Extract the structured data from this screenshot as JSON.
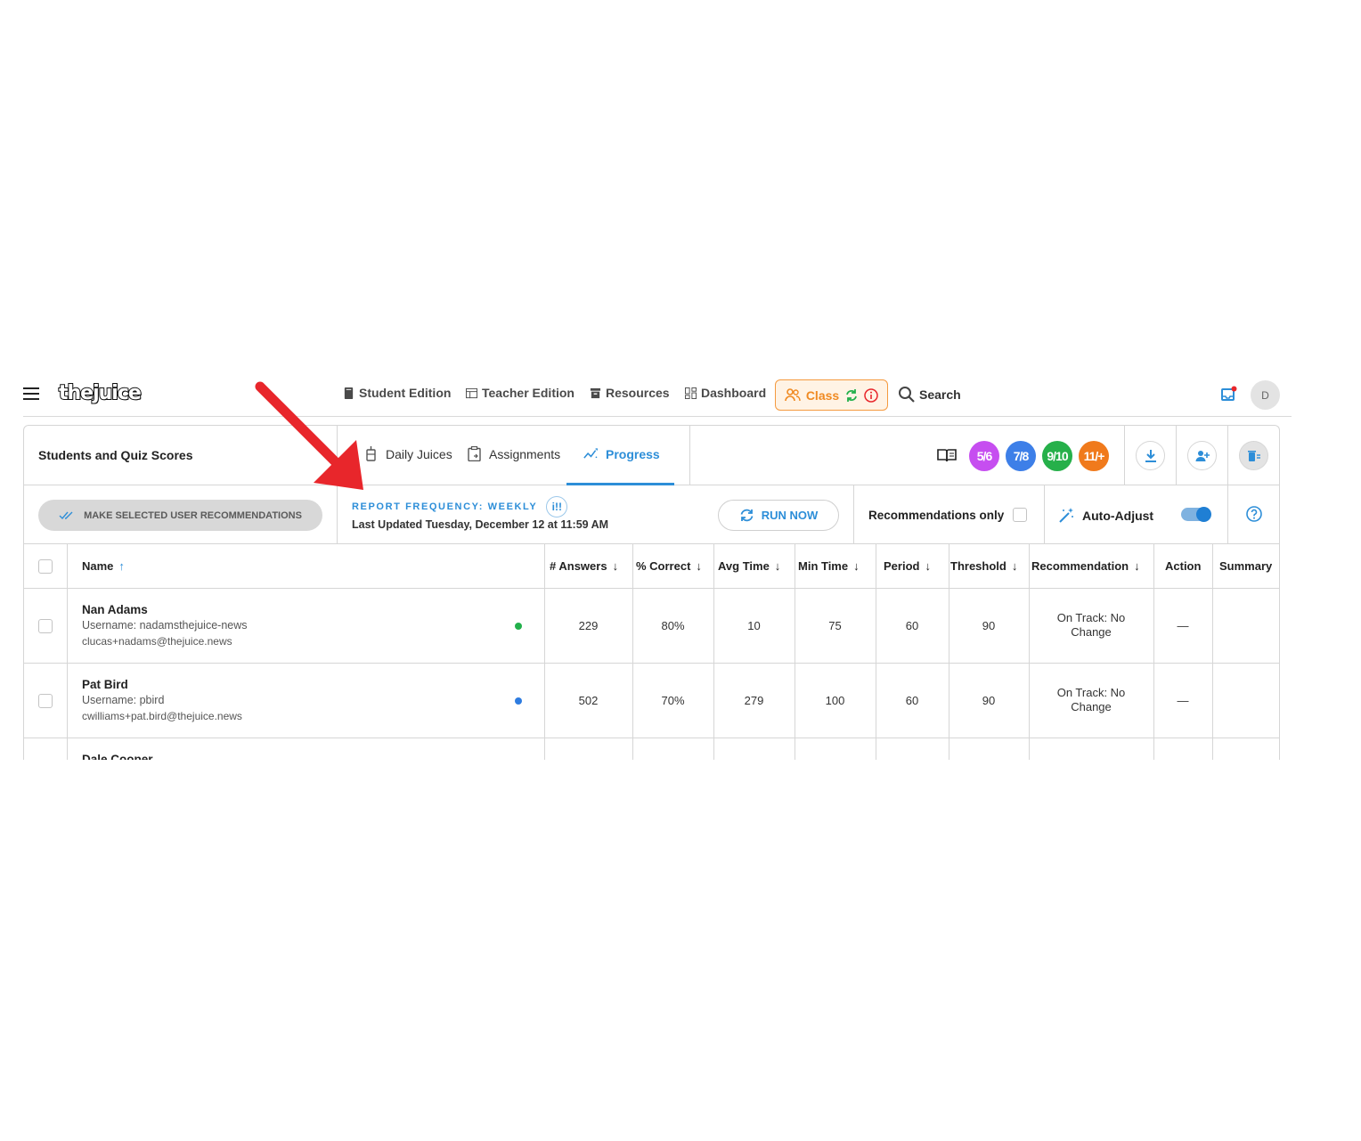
{
  "nav": {
    "logo": "thejuice",
    "student_edition": "Student Edition",
    "teacher_edition": "Teacher Edition",
    "resources": "Resources",
    "dashboard": "Dashboard",
    "class": "Class",
    "search": "Search",
    "avatar_initial": "D"
  },
  "header": {
    "title": "Students and Quiz Scores",
    "tabs": [
      {
        "label": "Daily Juices"
      },
      {
        "label": "Assignments"
      },
      {
        "label": "Progress",
        "active": true
      }
    ],
    "grades": [
      {
        "label": "5/6",
        "color": "#c64ef0"
      },
      {
        "label": "7/8",
        "color": "#3d7fe8"
      },
      {
        "label": "9/10",
        "color": "#26b04a"
      },
      {
        "label": "11/+",
        "color": "#f07a1c"
      }
    ]
  },
  "toolbar": {
    "make_recommendations": "MAKE SELECTED USER RECOMMENDATIONS",
    "report_frequency": "REPORT FREQUENCY: WEEKLY",
    "last_updated": "Last Updated Tuesday, December 12 at 11:59 AM",
    "run_now": "RUN NOW",
    "recommendations_only": "Recommendations only",
    "auto_adjust": "Auto-Adjust"
  },
  "table": {
    "columns": [
      "Name",
      "# Answers",
      "% Correct",
      "Avg Time",
      "Min Time",
      "Period",
      "Threshold",
      "Recommendation",
      "Action",
      "Summary"
    ],
    "rows": [
      {
        "name": "Nan Adams",
        "username": "Username: nadamsthejuice-news",
        "email": "clucas+nadams@thejuice.news",
        "status_color": "#22b04b",
        "answers": "229",
        "correct": "80%",
        "avg_time": "10",
        "min_time": "75",
        "period": "60",
        "threshold": "90",
        "recommendation": "On Track: No Change",
        "action": "—"
      },
      {
        "name": "Pat Bird",
        "username": "Username: pbird",
        "email": "cwilliams+pat.bird@thejuice.news",
        "status_color": "#2e7ce0",
        "answers": "502",
        "correct": "70%",
        "avg_time": "279",
        "min_time": "100",
        "period": "60",
        "threshold": "90",
        "recommendation": "On Track: No Change",
        "action": "—"
      },
      {
        "name": "Dale Cooper"
      }
    ]
  },
  "colors": {
    "accent": "#2d8ed8",
    "class_orange": "#f08a22",
    "annotation_red": "#e8262b"
  }
}
